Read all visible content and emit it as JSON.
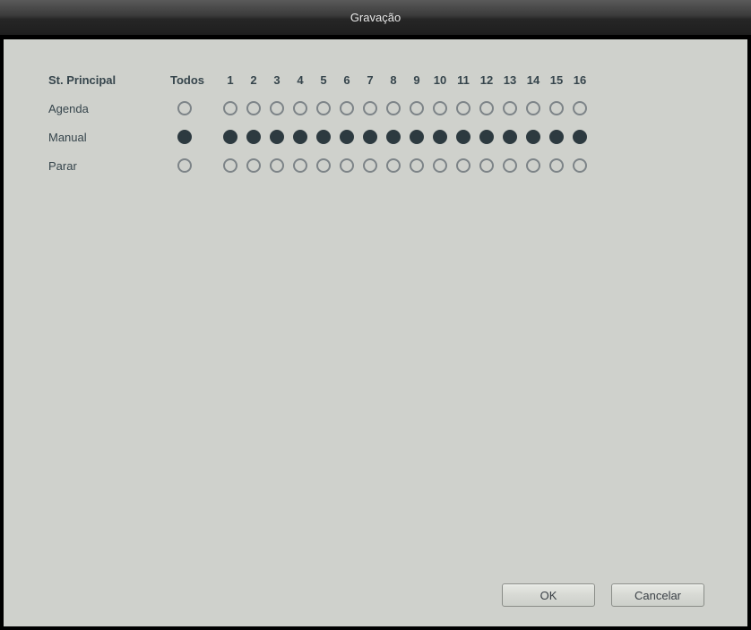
{
  "title": "Gravação",
  "header": {
    "principal": "St. Principal",
    "todos": "Todos",
    "channels": [
      "1",
      "2",
      "3",
      "4",
      "5",
      "6",
      "7",
      "8",
      "9",
      "10",
      "11",
      "12",
      "13",
      "14",
      "15",
      "16"
    ]
  },
  "rows": [
    {
      "key": "agenda",
      "label": "Agenda",
      "todos_selected": false,
      "channels_selected": [
        false,
        false,
        false,
        false,
        false,
        false,
        false,
        false,
        false,
        false,
        false,
        false,
        false,
        false,
        false,
        false
      ]
    },
    {
      "key": "manual",
      "label": "Manual",
      "todos_selected": true,
      "channels_selected": [
        true,
        true,
        true,
        true,
        true,
        true,
        true,
        true,
        true,
        true,
        true,
        true,
        true,
        true,
        true,
        true
      ]
    },
    {
      "key": "parar",
      "label": "Parar",
      "todos_selected": false,
      "channels_selected": [
        false,
        false,
        false,
        false,
        false,
        false,
        false,
        false,
        false,
        false,
        false,
        false,
        false,
        false,
        false,
        false
      ]
    }
  ],
  "buttons": {
    "ok": "OK",
    "cancel": "Cancelar"
  }
}
